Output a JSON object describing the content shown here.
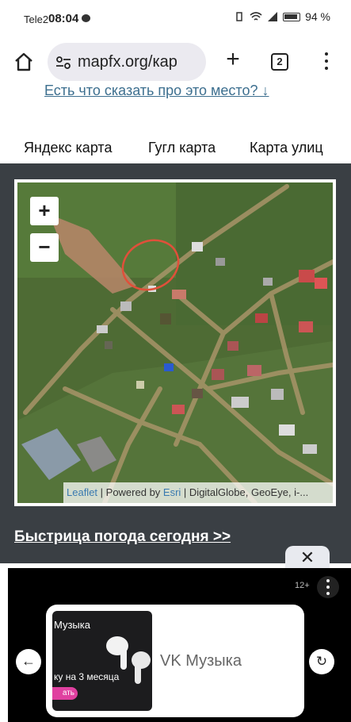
{
  "status_bar": {
    "carrier": "Tele2",
    "time": "08:04",
    "battery": "94 %"
  },
  "browser": {
    "url": "mapfx.org/кар",
    "tab_count": "2"
  },
  "page": {
    "top_link": "Есть что сказать про это место? ↓",
    "map_tabs": [
      "Яндекс карта",
      "Гугл карта",
      "Карта улиц"
    ],
    "zoom_in": "+",
    "zoom_out": "−",
    "attribution": {
      "leaflet": "Leaflet",
      "sep1": " | Powered by ",
      "esri": "Esri",
      "rest": " | DigitalGlobe, GeoEye, i-..."
    },
    "weather_link": "Быстрица погода сегодня >>"
  },
  "ad": {
    "close": "✕",
    "age_rating": "12+",
    "image_title": "Музыка",
    "image_subtitle": "ку на 3 месяца",
    "image_button": "ать",
    "name": "VK Музыка",
    "prev": "←",
    "reload": "↻"
  },
  "colors": {
    "link": "#3d6f8f",
    "map_section_bg": "#3a3f44",
    "ad_bg": "#000000",
    "url_pill": "#ebeaf0",
    "map_circle": "#e0503a"
  },
  "icons": [
    "home-icon",
    "site-settings-icon",
    "new-tab-icon",
    "tab-switcher-icon",
    "overflow-menu-icon",
    "close-icon",
    "back-arrow-icon",
    "reload-icon"
  ]
}
